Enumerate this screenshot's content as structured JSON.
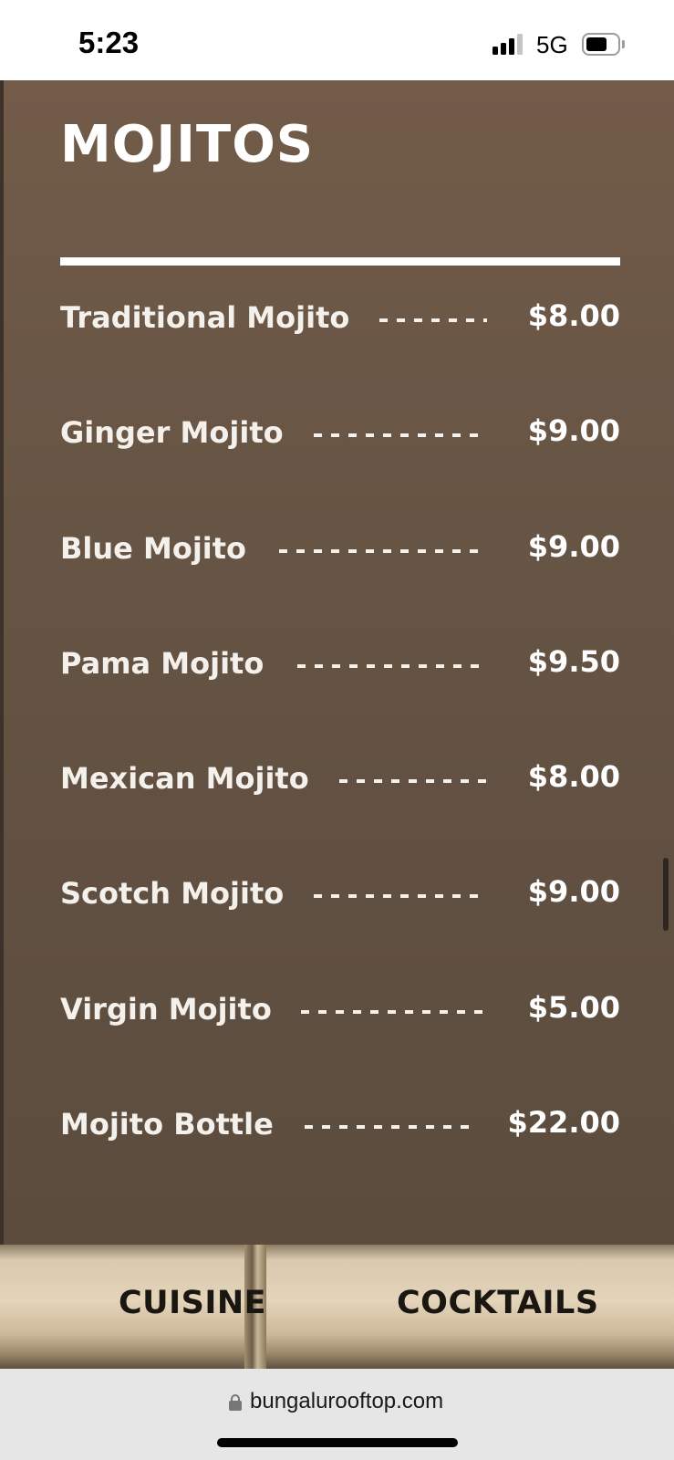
{
  "status_bar": {
    "time": "5:23",
    "network": "5G",
    "battery_level": 0.6,
    "signal_bars": 3
  },
  "menu": {
    "title": "MOJITOS",
    "items": [
      {
        "name": "Traditional Mojito",
        "price": "$8.00"
      },
      {
        "name": "Ginger Mojito",
        "price": "$9.00"
      },
      {
        "name": "Blue Mojito",
        "price": "$9.00"
      },
      {
        "name": "Pama Mojito",
        "price": "$9.50"
      },
      {
        "name": "Mexican Mojito",
        "price": "$8.00"
      },
      {
        "name": "Scotch Mojito",
        "price": "$9.00"
      },
      {
        "name": "Virgin Mojito",
        "price": "$5.00"
      },
      {
        "name": "Mojito Bottle",
        "price": "$22.00"
      }
    ]
  },
  "nav": {
    "cuisine": "CUISINE",
    "cocktails": "COCKTAILS"
  },
  "browser": {
    "url": "bungalurooftop.com"
  },
  "colors": {
    "panel_top": "#725b49",
    "panel_bottom": "#5b4c3e",
    "text": "#ffffff",
    "nav_text": "#1a1612"
  }
}
